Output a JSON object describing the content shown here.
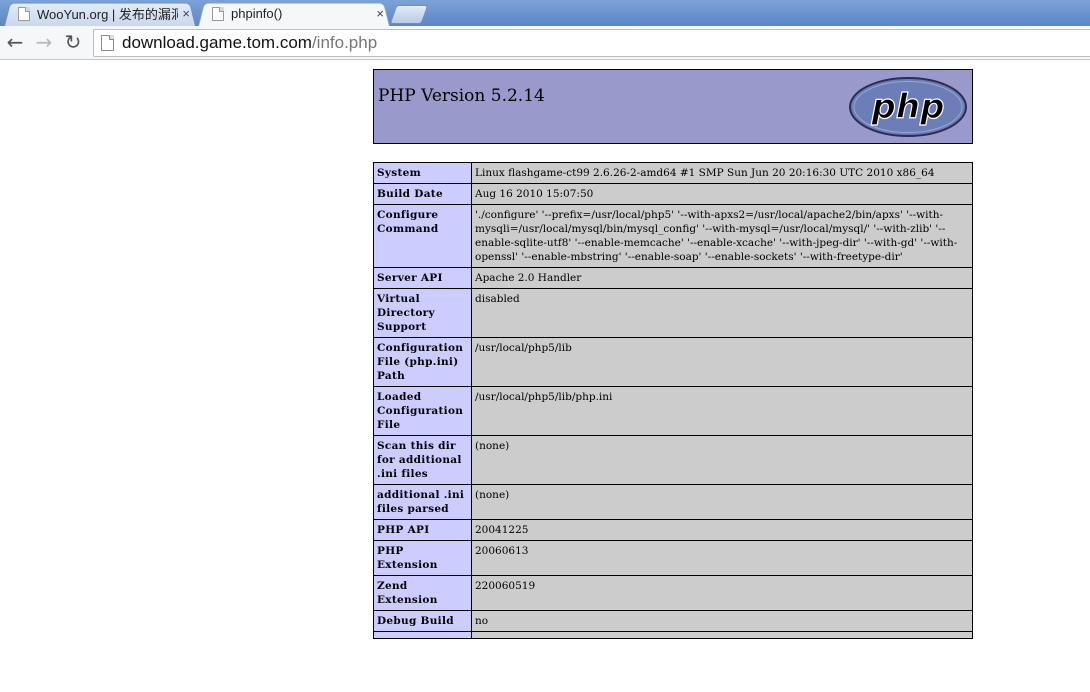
{
  "browser": {
    "tabs": [
      {
        "title": "WooYun.org | 发布的漏洞",
        "active": false
      },
      {
        "title": "phpinfo()",
        "active": true
      }
    ],
    "close_glyph": "×",
    "address": {
      "host": "download.game.tom.com",
      "path": "/info.php"
    }
  },
  "phpinfo": {
    "version_title": "PHP Version 5.2.14",
    "logo_text": "php",
    "rows": [
      {
        "label": "System",
        "value": "Linux flashgame-ct99 2.6.26-2-amd64 #1 SMP Sun Jun 20 20:16:30 UTC 2010 x86_64"
      },
      {
        "label": "Build Date",
        "value": "Aug 16 2010 15:07:50"
      },
      {
        "label": "Configure Command",
        "value": "'./configure' '--prefix=/usr/local/php5' '--with-apxs2=/usr/local/apache2/bin/apxs' '--with-mysqli=/usr/local/mysql/bin/mysql_config' '--with-mysql=/usr/local/mysql/' '--with-zlib' '--enable-sqlite-utf8' '--enable-memcache' '--enable-xcache' '--with-jpeg-dir' '--with-gd' '--with-openssl' '--enable-mbstring' '--enable-soap' '--enable-sockets' '--with-freetype-dir'"
      },
      {
        "label": "Server API",
        "value": "Apache 2.0 Handler"
      },
      {
        "label": "Virtual Directory Support",
        "value": "disabled"
      },
      {
        "label": "Configuration File (php.ini) Path",
        "value": "/usr/local/php5/lib"
      },
      {
        "label": "Loaded Configuration File",
        "value": "/usr/local/php5/lib/php.ini"
      },
      {
        "label": "Scan this dir for additional .ini files",
        "value": "(none)"
      },
      {
        "label": "additional .ini files parsed",
        "value": "(none)"
      },
      {
        "label": "PHP API",
        "value": "20041225"
      },
      {
        "label": "PHP Extension",
        "value": "20060613"
      },
      {
        "label": "Zend Extension",
        "value": "220060519"
      },
      {
        "label": "Debug Build",
        "value": "no"
      },
      {
        "label": "",
        "value": ""
      }
    ]
  }
}
